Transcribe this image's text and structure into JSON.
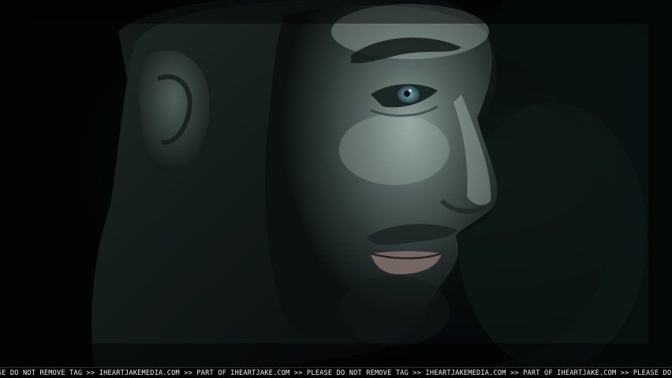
{
  "scene": {
    "description_icon": "portrait-photo",
    "palette": {
      "background": "#020404",
      "skin_highlight": "#9fb2ab",
      "skin_mid": "#4c5c58",
      "skin_shadow": "#1a2422",
      "eye": "#5e8a96",
      "lips": "#8f7a76"
    }
  },
  "watermark": {
    "text": "EASE DO NOT REMOVE TAG >> IHEARTJAKEMEDIA.COM >> PART OF IHEARTJAKE.COM >> PLEASE DO NOT REMOVE TAG >> IHEARTJAKEMEDIA.COM >> PART OF IHEARTJAKE.COM >> PLEASE DO NOT REMOVE TAG >> IHEARTJAKEN"
  }
}
